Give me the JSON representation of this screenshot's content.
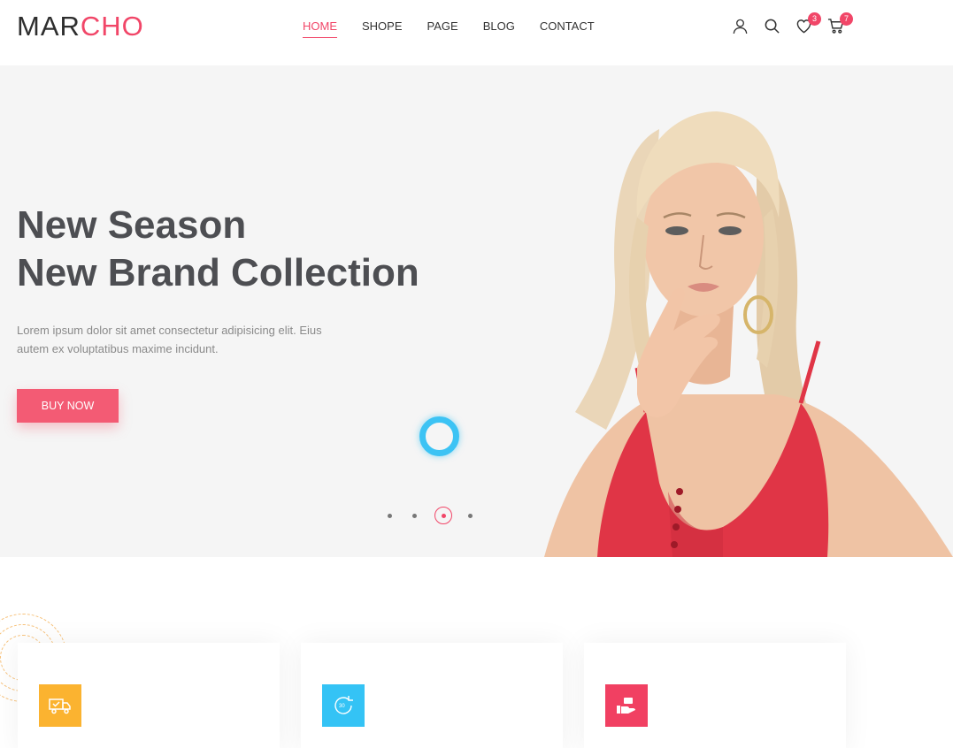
{
  "brand": {
    "logo_part1": "MAR",
    "logo_part2": "CHO",
    "accent_color": "#f14668"
  },
  "nav": {
    "items": [
      {
        "label": "HOME",
        "active": true
      },
      {
        "label": "SHOPE",
        "active": false
      },
      {
        "label": "PAGE",
        "active": false
      },
      {
        "label": "BLOG",
        "active": false
      },
      {
        "label": "CONTACT",
        "active": false
      }
    ]
  },
  "header_icons": {
    "user": "user-icon",
    "search": "search-icon",
    "wishlist": {
      "icon": "heart-icon",
      "count": "3"
    },
    "cart": {
      "icon": "cart-icon",
      "count": "7"
    }
  },
  "hero": {
    "title_line1": "New Season",
    "title_line2": "New Brand Collection",
    "description": "Lorem ipsum dolor sit amet consectetur adipisicing elit. Eius autem ex voluptatibus maxime incidunt.",
    "button_label": "BUY NOW",
    "slider_dots": 4,
    "active_dot": 3,
    "button_color": "#f35b74",
    "ring_color": "#3cc3f4"
  },
  "services": {
    "cards": [
      {
        "icon": "delivery-truck-icon",
        "color": "#fbb330"
      },
      {
        "icon": "return-30-day-icon",
        "color": "#34c3f5"
      },
      {
        "icon": "secure-payment-hand-icon",
        "color": "#f14062"
      }
    ]
  }
}
